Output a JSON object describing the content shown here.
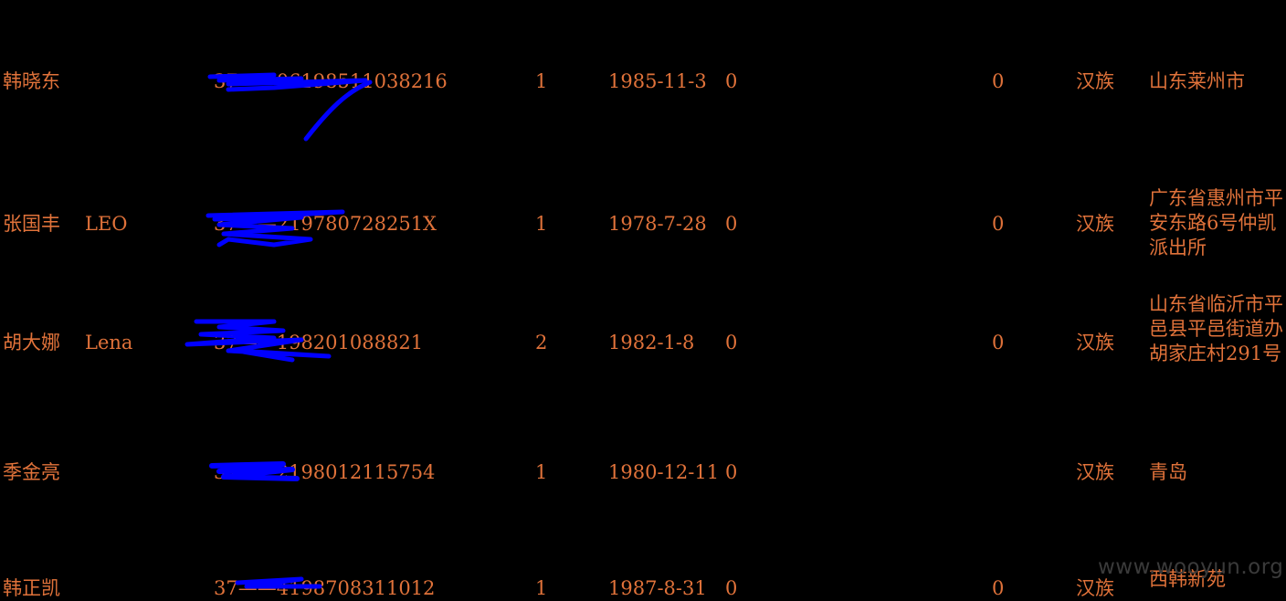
{
  "rows": [
    {
      "name": "韩晓东",
      "english_name": "",
      "id_number": "37——06198511038216",
      "gender": "1",
      "birth_date": "1985-11-3",
      "field1": "0",
      "field2": "0",
      "ethnicity": "汉族",
      "address": "山东莱州市"
    },
    {
      "name": "张国丰",
      "english_name": "LEO",
      "id_number": "37——219780728251X",
      "gender": "1",
      "birth_date": "1978-7-28",
      "field1": "0",
      "field2": "0",
      "ethnicity": "汉族",
      "address": "广东省惠州市平安东路6号仲凯派出所"
    },
    {
      "name": "胡大娜",
      "english_name": "Lena",
      "id_number": "37——198201088821",
      "gender": "2",
      "birth_date": "1982-1-8",
      "field1": "0",
      "field2": "0",
      "ethnicity": "汉族",
      "address": "山东省临沂市平邑县平邑街道办胡家庄村291号"
    },
    {
      "name": "季金亮",
      "english_name": "",
      "id_number": "37——2198012115754",
      "gender": "1",
      "birth_date": "1980-12-11",
      "field1": "0",
      "field2": "",
      "ethnicity": "汉族",
      "address": "青岛"
    },
    {
      "name": "韩正凯",
      "english_name": "",
      "id_number": "37——4198708311012",
      "gender": "1",
      "birth_date": "1987-8-31",
      "field1": "0",
      "field2": "0",
      "ethnicity": "汉族",
      "address": "西韩新苑"
    }
  ],
  "watermark": "www.wooyun.org",
  "colors": {
    "text": "#e0723a",
    "background": "#000000",
    "redaction": "#0000ff"
  }
}
